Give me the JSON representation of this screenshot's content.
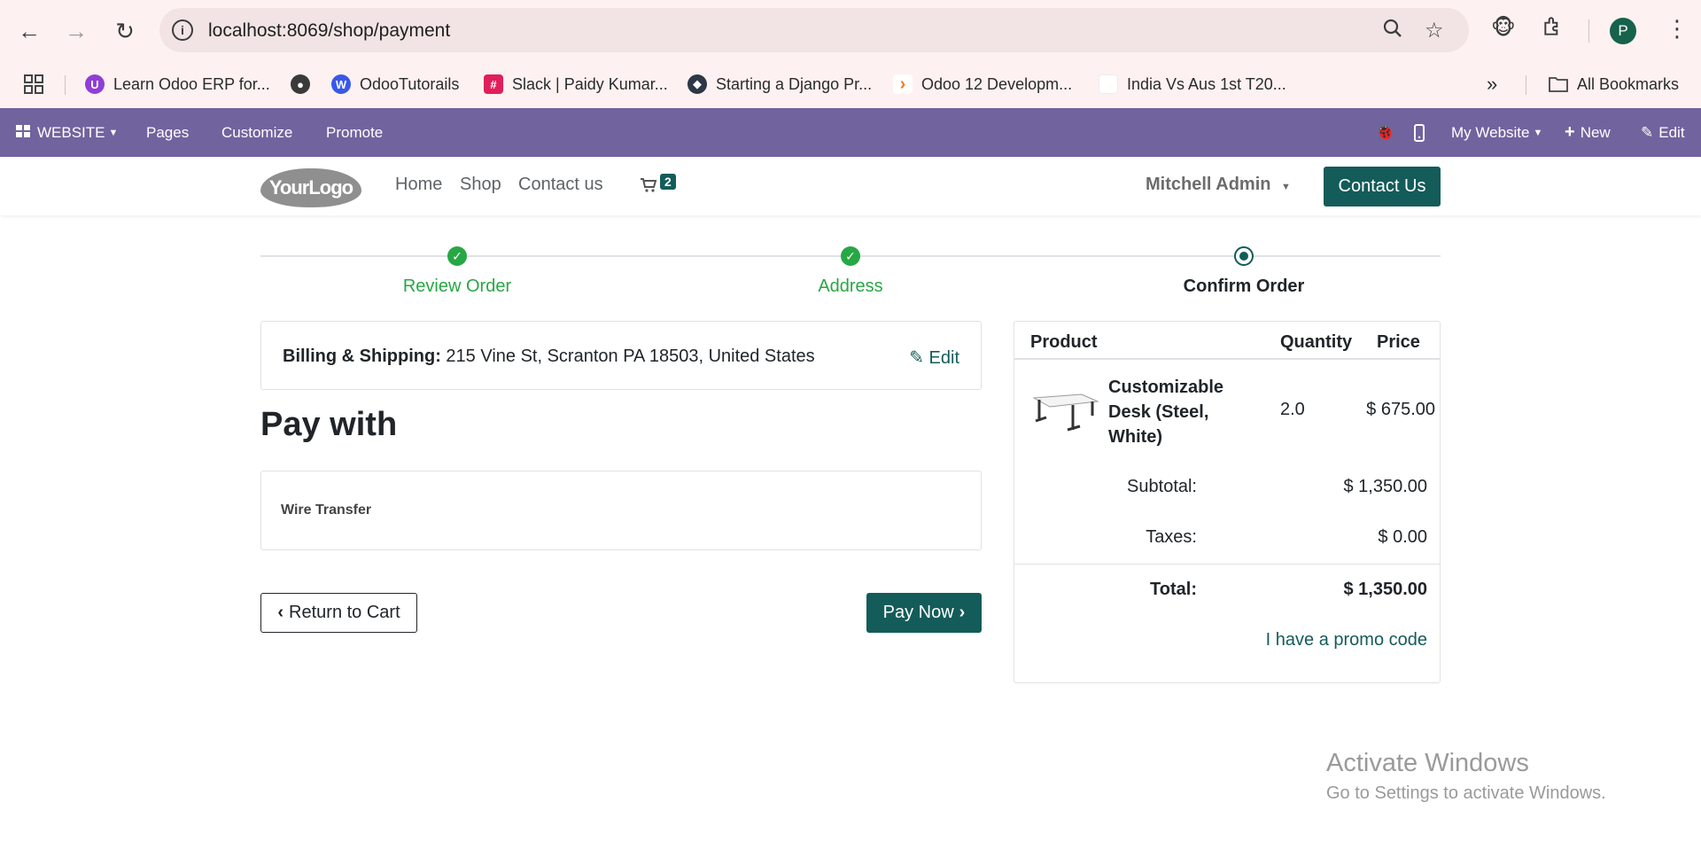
{
  "browser": {
    "url": "localhost:8069/shop/payment",
    "bookmarks": [
      {
        "label": "Learn Odoo ERP for..."
      },
      {
        "label": "OdooTutorails"
      },
      {
        "label": "Slack | Paidy Kumar..."
      },
      {
        "label": "Starting a Django Pr..."
      },
      {
        "label": "Odoo 12 Developm..."
      },
      {
        "label": "India Vs Aus 1st T20..."
      }
    ],
    "all_bookmarks": "All Bookmarks",
    "profile_initial": "P",
    "more_bookmarks": "»"
  },
  "odoo_bar": {
    "website": "WEBSITE",
    "pages": "Pages",
    "customize": "Customize",
    "promote": "Promote",
    "my_website": "My Website",
    "new": "New",
    "edit": "Edit"
  },
  "header": {
    "logo_text": "YourLogo",
    "nav": [
      "Home",
      "Shop",
      "Contact us"
    ],
    "cart_count": "2",
    "user": "Mitchell Admin",
    "contact_button": "Contact Us"
  },
  "steps": [
    {
      "label": "Review Order",
      "state": "done"
    },
    {
      "label": "Address",
      "state": "done"
    },
    {
      "label": "Confirm Order",
      "state": "current"
    }
  ],
  "billing": {
    "label": "Billing & Shipping:",
    "address": "215 Vine St, Scranton PA 18503, United States",
    "edit": "Edit"
  },
  "payment": {
    "heading": "Pay with",
    "method": "Wire Transfer",
    "return_button": "Return to Cart",
    "pay_button": "Pay Now"
  },
  "summary": {
    "headers": {
      "product": "Product",
      "quantity": "Quantity",
      "price": "Price"
    },
    "product": {
      "name": "Customizable Desk (Steel, White)",
      "quantity": "2.0",
      "price": "$ 675.00"
    },
    "subtotal_label": "Subtotal:",
    "subtotal": "$ 1,350.00",
    "taxes_label": "Taxes:",
    "taxes": "$ 0.00",
    "total_label": "Total:",
    "total": "$ 1,350.00",
    "promo": "I have a promo code"
  },
  "watermark": {
    "line1": "Activate Windows",
    "line2": "Go to Settings to activate Windows."
  },
  "colors": {
    "odoo_bar": "#71639e",
    "primary": "#135c5a",
    "success": "#28a745"
  }
}
